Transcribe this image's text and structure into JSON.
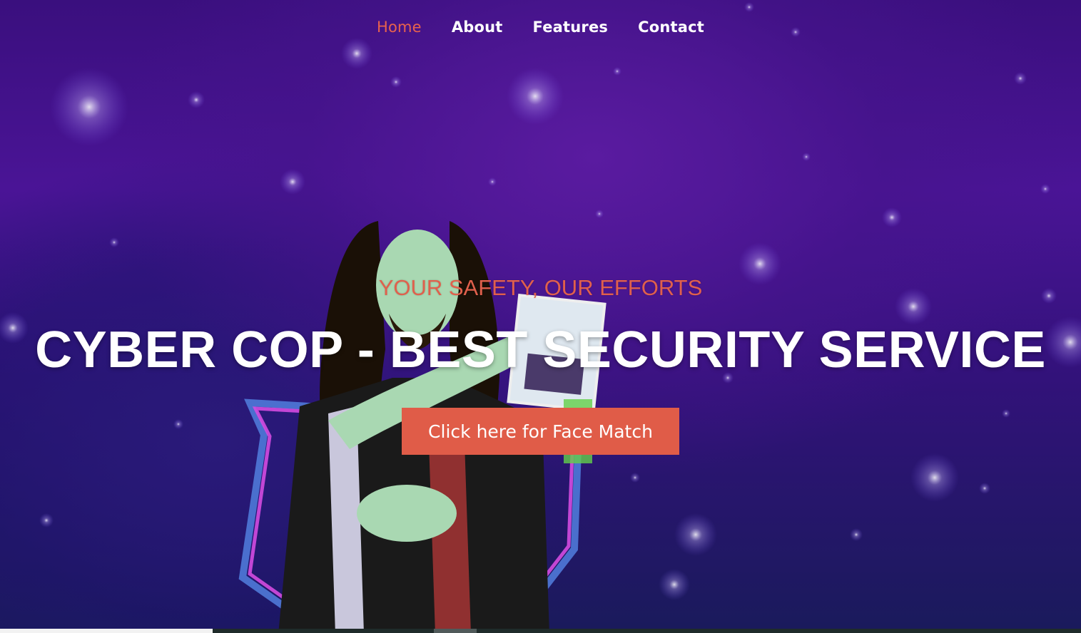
{
  "nav": {
    "items": [
      {
        "label": "Home",
        "active": true
      },
      {
        "label": "About",
        "active": false
      },
      {
        "label": "Features",
        "active": false
      },
      {
        "label": "Contact",
        "active": false
      }
    ]
  },
  "hero": {
    "tagline": "YOUR SAFETY, OUR EFFORTS",
    "headline": "CYBER COP - BEST SECURITY SERVICE",
    "cta_label": "Click here for Face Match",
    "background_image": "starry-purple-sky-with-person-holding-photo"
  },
  "colors": {
    "accent": "#e05c48",
    "background": "#4a1496",
    "text": "#ffffff"
  }
}
